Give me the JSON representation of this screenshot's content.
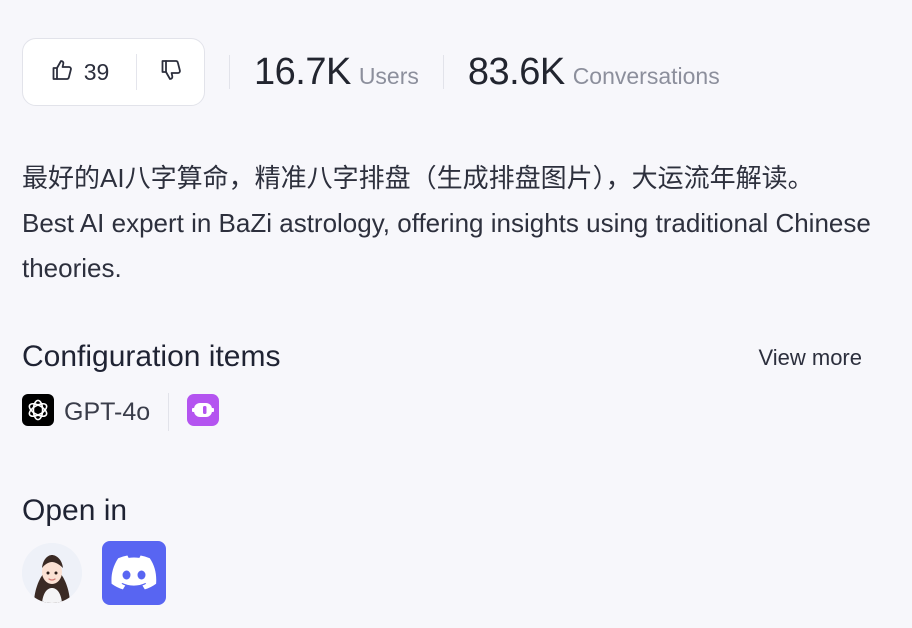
{
  "votes": {
    "like_count": "39",
    "like_icon": "thumbs-up-icon",
    "dislike_icon": "thumbs-down-icon"
  },
  "stats": [
    {
      "value": "16.7K",
      "label": "Users"
    },
    {
      "value": "83.6K",
      "label": "Conversations"
    }
  ],
  "description": {
    "line_cn": "最好的AI八字算命，精准八字排盘（生成排盘图片），大运流年解读。",
    "line_en": "Best AI expert in BaZi astrology, offering insights using traditional Chinese theories."
  },
  "configuration": {
    "title": "Configuration items",
    "view_more": "View more",
    "model": {
      "name": "GPT-4o",
      "icon": "openai-icon"
    },
    "plugin_icon": "plugin-icon",
    "plugin_color": "#b454f0"
  },
  "open_in": {
    "title": "Open in",
    "platforms": [
      {
        "icon": "avatar-icon"
      },
      {
        "icon": "discord-icon",
        "color": "#5865f2"
      }
    ]
  },
  "colors": {
    "background": "#f7f7fb",
    "text_primary": "#1f2333",
    "text_muted": "#8c8f9c",
    "border": "#e2e3ea"
  }
}
